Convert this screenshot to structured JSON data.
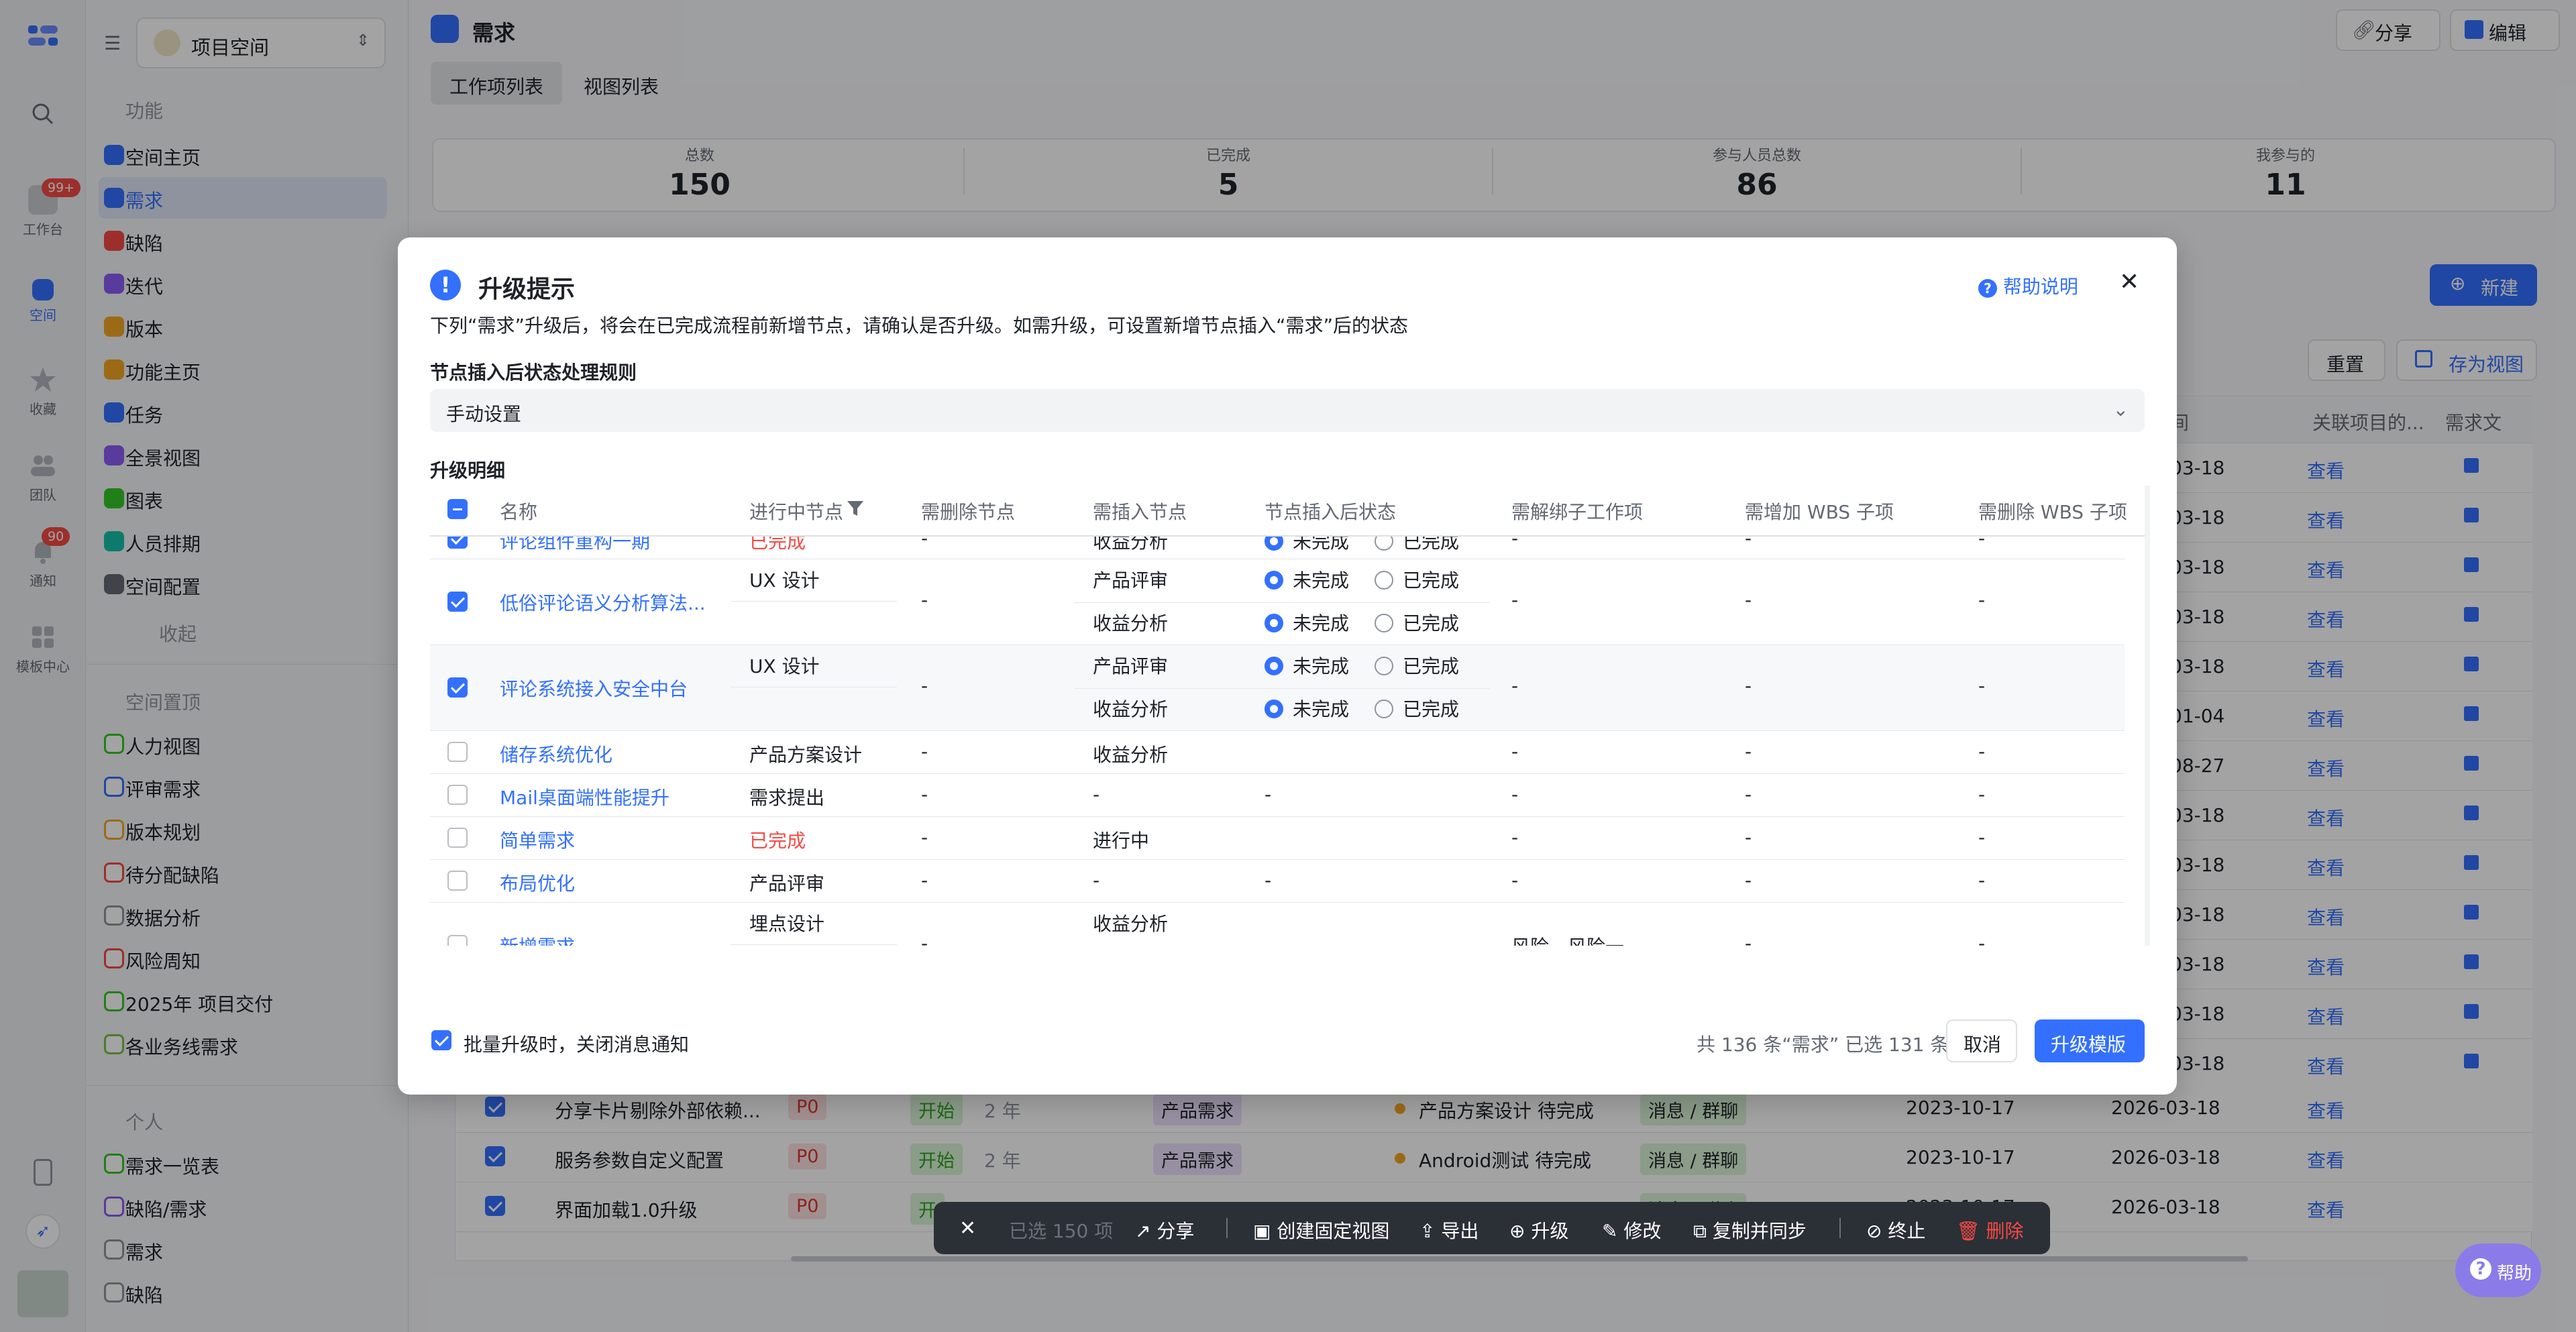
{
  "rail": {
    "items": [
      {
        "label": "工作台",
        "badge": "99+"
      },
      {
        "label": "空间"
      },
      {
        "label": "收藏"
      },
      {
        "label": "团队"
      },
      {
        "label": "通知",
        "badge": "90"
      },
      {
        "label": "模板中心"
      }
    ]
  },
  "sidebar": {
    "space_name": "项目空间",
    "section_func": "功能",
    "items": [
      {
        "label": "空间主页",
        "color": "#3370ff"
      },
      {
        "label": "需求",
        "color": "#3370ff"
      },
      {
        "label": "缺陷",
        "color": "#f54a45"
      },
      {
        "label": "迭代",
        "color": "#8b5cf6"
      },
      {
        "label": "版本",
        "color": "#f5a623"
      },
      {
        "label": "功能主页",
        "color": "#f5a623"
      },
      {
        "label": "任务",
        "color": "#3370ff"
      },
      {
        "label": "全景视图",
        "color": "#8b5cf6"
      },
      {
        "label": "图表",
        "color": "#34c724"
      },
      {
        "label": "人员排期",
        "color": "#14c0a8"
      },
      {
        "label": "空间配置",
        "color": "#646a73"
      }
    ],
    "collapse": "收起",
    "section_pinned": "空间置顶",
    "pinned": [
      {
        "label": "人力视图"
      },
      {
        "label": "评审需求"
      },
      {
        "label": "版本规划"
      },
      {
        "label": "待分配缺陷"
      },
      {
        "label": "数据分析"
      },
      {
        "label": "风险周知"
      },
      {
        "label": "2025年 项目交付"
      },
      {
        "label": "各业务线需求"
      }
    ],
    "section_personal": "个人",
    "personal": [
      {
        "label": "需求一览表"
      },
      {
        "label": "缺陷/需求"
      },
      {
        "label": "需求"
      },
      {
        "label": "缺陷"
      }
    ]
  },
  "header": {
    "title": "需求",
    "share": "分享",
    "edit": "编辑",
    "tabs": [
      "工作项列表",
      "视图列表"
    ],
    "new_btn": "新建",
    "reset_btn": "重置",
    "save_view": "存为视图"
  },
  "stats": [
    {
      "label": "总数",
      "value": "150"
    },
    {
      "label": "已完成",
      "value": "5"
    },
    {
      "label": "参与人员总数",
      "value": "86"
    },
    {
      "label": "我参与的",
      "value": "11"
    }
  ],
  "bg_table": {
    "col_headers": [
      "间",
      "关联项目的...",
      "需求文"
    ],
    "right_dates": [
      "03-18",
      "03-18",
      "03-18",
      "03-18",
      "03-18",
      "01-04",
      "08-27",
      "03-18",
      "03-18",
      "03-18",
      "03-18",
      "03-18",
      "03-18"
    ],
    "view_link": "查看",
    "rows": [
      {
        "name": "分享卡片剔除外部依赖...",
        "priority": "P0",
        "status": "开始",
        "age": "2 年",
        "type": "产品需求",
        "node": "产品方案设计 待完成",
        "channel": "消息 / 群聊",
        "start": "2023-10-17",
        "end": "2026-03-18",
        "link": "查看"
      },
      {
        "name": "服务参数自定义配置",
        "priority": "P0",
        "status": "开始",
        "age": "2 年",
        "type": "产品需求",
        "node": "Android测试 待完成",
        "channel": "消息 / 群聊",
        "start": "2023-10-17",
        "end": "2026-03-18",
        "link": "查看"
      },
      {
        "name": "界面加载1.0升级",
        "priority": "P0",
        "status": "开",
        "age": "",
        "type": "",
        "node": "",
        "channel": "消息 / 群聊",
        "start": "2023-10-17",
        "end": "2026-03-18",
        "link": "查看"
      }
    ]
  },
  "modal": {
    "title": "升级提示",
    "help": "帮助说明",
    "desc": "下列“需求”升级后，将会在已完成流程前新增节点，请确认是否升级。如需升级，可设置新增节点插入“需求”后的状态",
    "rule_label": "节点插入后状态处理规则",
    "rule_value": "手动设置",
    "detail_label": "升级明细",
    "columns": [
      "名称",
      "进行中节点",
      "需删除节点",
      "需插入节点",
      "节点插入后状态",
      "需解绑子工作项",
      "需增加 WBS 子项",
      "需删除 WBS 子项"
    ],
    "opt_undone": "未完成",
    "opt_done": "已完成",
    "dash": "-",
    "rows": [
      {
        "name": "评论组件重构一期",
        "progress": "已完成",
        "insert": "收益分析"
      },
      {
        "name": "低俗评论语义分析算法...",
        "progress": "UX 设计",
        "insert1": "产品评审",
        "insert2": "收益分析"
      },
      {
        "name": "评论系统接入安全中台",
        "progress": "UX 设计",
        "insert1": "产品评审",
        "insert2": "收益分析"
      },
      {
        "name": "储存系统优化",
        "progress": "产品方案设计",
        "insert": "收益分析"
      },
      {
        "name": "Mail桌面端性能提升",
        "progress": "需求提出",
        "insert": "-"
      },
      {
        "name": "简单需求",
        "progress": "已完成",
        "insert": "进行中"
      },
      {
        "name": "布局优化",
        "progress": "产品评审",
        "insert": "-"
      },
      {
        "name": "新增需求",
        "progress": "埋点设计",
        "insert": "收益分析",
        "unbind": "风险、风险一"
      }
    ],
    "footer_check": "批量升级时，关闭消息通知",
    "summary": "共 136 条“需求” 已选 131 条",
    "cancel": "取消",
    "confirm": "升级模版"
  },
  "action_bar": {
    "selected": "已选 150 项",
    "share": "分享",
    "fixed_view": "创建固定视图",
    "export": "导出",
    "upgrade": "升级",
    "modify": "修改",
    "copy_sync": "复制并同步",
    "terminate": "终止",
    "delete": "删除"
  },
  "help_fab": "帮助"
}
